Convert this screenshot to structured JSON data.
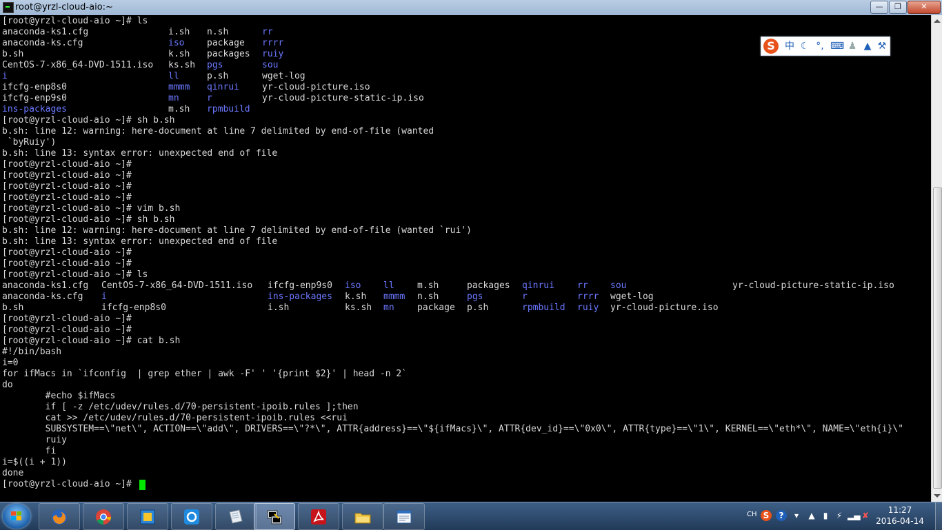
{
  "window": {
    "title": "root@yrzl-cloud-aio:~"
  },
  "terminal": {
    "lines": [
      [
        {
          "t": "[root@yrzl-cloud-aio ~]# ls",
          "c": 0
        }
      ],
      [
        {
          "t": "anaconda-ks1.cfg",
          "c": 0
        },
        {
          "t": "i.sh",
          "c": 30
        },
        {
          "t": "n.sh",
          "c": 37
        },
        {
          "t": "rr",
          "c": 47,
          "dir": true
        }
      ],
      [
        {
          "t": "anaconda-ks.cfg",
          "c": 0
        },
        {
          "t": "iso",
          "c": 30,
          "dir": true
        },
        {
          "t": "package",
          "c": 37
        },
        {
          "t": "rrrr",
          "c": 47,
          "dir": true
        }
      ],
      [
        {
          "t": "b.sh",
          "c": 0
        },
        {
          "t": "k.sh",
          "c": 30
        },
        {
          "t": "packages",
          "c": 37
        },
        {
          "t": "ruiy",
          "c": 47,
          "dir": true
        }
      ],
      [
        {
          "t": "CentOS-7-x86_64-DVD-1511.iso",
          "c": 0
        },
        {
          "t": "ks.sh",
          "c": 30
        },
        {
          "t": "pgs",
          "c": 37,
          "dir": true
        },
        {
          "t": "sou",
          "c": 47,
          "dir": true
        }
      ],
      [
        {
          "t": "i",
          "c": 0,
          "dir": true
        },
        {
          "t": "ll",
          "c": 30,
          "dir": true
        },
        {
          "t": "p.sh",
          "c": 37
        },
        {
          "t": "wget-log",
          "c": 47
        }
      ],
      [
        {
          "t": "ifcfg-enp8s0",
          "c": 0
        },
        {
          "t": "mmmm",
          "c": 30,
          "dir": true
        },
        {
          "t": "qinrui",
          "c": 37,
          "dir": true
        },
        {
          "t": "yr-cloud-picture.iso",
          "c": 47
        }
      ],
      [
        {
          "t": "ifcfg-enp9s0",
          "c": 0
        },
        {
          "t": "mn",
          "c": 30,
          "dir": true
        },
        {
          "t": "r",
          "c": 37,
          "dir": true
        },
        {
          "t": "yr-cloud-picture-static-ip.iso",
          "c": 47
        }
      ],
      [
        {
          "t": "ins-packages",
          "c": 0,
          "dir": true
        },
        {
          "t": "m.sh",
          "c": 30
        },
        {
          "t": "rpmbuild",
          "c": 37,
          "dir": true
        }
      ],
      [
        {
          "t": "[root@yrzl-cloud-aio ~]# sh b.sh",
          "c": 0
        }
      ],
      [
        {
          "t": "b.sh: line 12: warning: here-document at line 7 delimited by end-of-file (wanted",
          "c": 0
        }
      ],
      [
        {
          "t": " `byRuiy')",
          "c": 0
        }
      ],
      [
        {
          "t": "b.sh: line 13: syntax error: unexpected end of file",
          "c": 0
        }
      ],
      [
        {
          "t": "[root@yrzl-cloud-aio ~]#",
          "c": 0
        }
      ],
      [
        {
          "t": "[root@yrzl-cloud-aio ~]#",
          "c": 0
        }
      ],
      [
        {
          "t": "[root@yrzl-cloud-aio ~]#",
          "c": 0
        }
      ],
      [
        {
          "t": "[root@yrzl-cloud-aio ~]#",
          "c": 0
        }
      ],
      [
        {
          "t": "[root@yrzl-cloud-aio ~]# vim b.sh",
          "c": 0
        }
      ],
      [
        {
          "t": "[root@yrzl-cloud-aio ~]# sh b.sh",
          "c": 0
        }
      ],
      [
        {
          "t": "b.sh: line 12: warning: here-document at line 7 delimited by end-of-file (wanted `rui')",
          "c": 0
        }
      ],
      [
        {
          "t": "b.sh: line 13: syntax error: unexpected end of file",
          "c": 0
        }
      ],
      [
        {
          "t": "[root@yrzl-cloud-aio ~]#",
          "c": 0
        }
      ],
      [
        {
          "t": "[root@yrzl-cloud-aio ~]#",
          "c": 0
        }
      ],
      [
        {
          "t": "[root@yrzl-cloud-aio ~]# ls",
          "c": 0
        }
      ],
      [
        {
          "t": "anaconda-ks1.cfg",
          "c": 0
        },
        {
          "t": "CentOS-7-x86_64-DVD-1511.iso",
          "c": 18
        },
        {
          "t": "ifcfg-enp9s0",
          "c": 48
        },
        {
          "t": "iso",
          "c": 62,
          "dir": true
        },
        {
          "t": "ll",
          "c": 69,
          "dir": true
        },
        {
          "t": "m.sh",
          "c": 75
        },
        {
          "t": "packages",
          "c": 84
        },
        {
          "t": "qinrui",
          "c": 94,
          "dir": true
        },
        {
          "t": "rr",
          "c": 104,
          "dir": true
        },
        {
          "t": "sou",
          "c": 110,
          "dir": true
        },
        {
          "t": "yr-cloud-picture-static-ip.iso",
          "c": 132
        }
      ],
      [
        {
          "t": "anaconda-ks.cfg",
          "c": 0
        },
        {
          "t": "i",
          "c": 18,
          "dir": true
        },
        {
          "t": "ins-packages",
          "c": 48,
          "dir": true
        },
        {
          "t": "k.sh",
          "c": 62
        },
        {
          "t": "mmmm",
          "c": 69,
          "dir": true
        },
        {
          "t": "n.sh",
          "c": 75
        },
        {
          "t": "pgs",
          "c": 84,
          "dir": true
        },
        {
          "t": "r",
          "c": 94,
          "dir": true
        },
        {
          "t": "rrrr",
          "c": 104,
          "dir": true
        },
        {
          "t": "wget-log",
          "c": 110
        }
      ],
      [
        {
          "t": "b.sh",
          "c": 0
        },
        {
          "t": "ifcfg-enp8s0",
          "c": 18
        },
        {
          "t": "i.sh",
          "c": 48
        },
        {
          "t": "ks.sh",
          "c": 62
        },
        {
          "t": "mn",
          "c": 69,
          "dir": true
        },
        {
          "t": "package",
          "c": 75
        },
        {
          "t": "p.sh",
          "c": 84
        },
        {
          "t": "rpmbuild",
          "c": 94,
          "dir": true
        },
        {
          "t": "ruiy",
          "c": 104,
          "dir": true
        },
        {
          "t": "yr-cloud-picture.iso",
          "c": 110
        }
      ],
      [
        {
          "t": "[root@yrzl-cloud-aio ~]#",
          "c": 0
        }
      ],
      [
        {
          "t": "[root@yrzl-cloud-aio ~]#",
          "c": 0
        }
      ],
      [
        {
          "t": "[root@yrzl-cloud-aio ~]# cat b.sh",
          "c": 0
        }
      ],
      [
        {
          "t": "#!/bin/bash",
          "c": 0
        }
      ],
      [
        {
          "t": "i=0",
          "c": 0
        }
      ],
      [
        {
          "t": "for ifMacs in `ifconfig  | grep ether | awk -F' ' '{print $2}' | head -n 2`",
          "c": 0
        }
      ],
      [
        {
          "t": "do",
          "c": 0
        }
      ],
      [
        {
          "t": "        #echo $ifMacs",
          "c": 0
        }
      ],
      [
        {
          "t": "        if [ -z /etc/udev/rules.d/70-persistent-ipoib.rules ];then",
          "c": 0
        }
      ],
      [
        {
          "t": "        cat >> /etc/udev/rules.d/70-persistent-ipoib.rules <<rui",
          "c": 0
        }
      ],
      [
        {
          "t": "        SUBSYSTEM==\\\"net\\\", ACTION==\\\"add\\\", DRIVERS==\\\"?*\\\", ATTR{address}==\\\"${ifMacs}\\\", ATTR{dev_id}==\\\"0x0\\\", ATTR{type}==\\\"1\\\", KERNEL==\\\"eth*\\\", NAME=\\\"eth{i}\\\"",
          "c": 0
        }
      ],
      [
        {
          "t": "        ruiy",
          "c": 0
        }
      ],
      [
        {
          "t": "        fi",
          "c": 0
        }
      ],
      [
        {
          "t": "i=$((i + 1))",
          "c": 0
        }
      ],
      [
        {
          "t": "done",
          "c": 0
        }
      ],
      [
        {
          "t": "[root@yrzl-cloud-aio ~]# ",
          "c": 0
        }
      ]
    ]
  },
  "ime": {
    "logo": "S",
    "mode_label": "中"
  },
  "tray": {
    "lang": "CH",
    "time": "11:27",
    "date": "2016-04-14"
  },
  "colors": {
    "dir": "#6b78ff",
    "text": "#d9d9d9",
    "cursor": "#00e600"
  }
}
